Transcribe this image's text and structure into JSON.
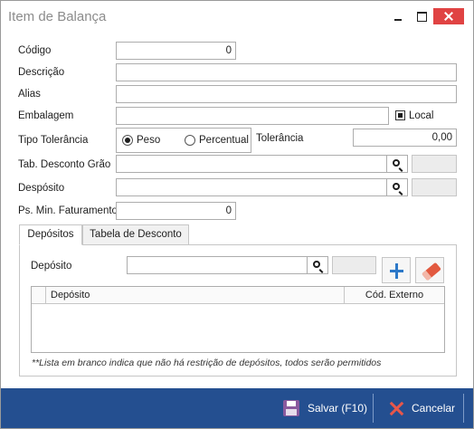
{
  "window": {
    "title": "Item de Balança"
  },
  "form": {
    "codigo": {
      "label": "Código",
      "value": "0"
    },
    "descricao": {
      "label": "Descrição",
      "value": ""
    },
    "alias": {
      "label": "Alias",
      "value": ""
    },
    "embalagem": {
      "label": "Embalagem",
      "value": "",
      "local_label": "Local",
      "local_checked": true
    },
    "tipo_tolerancia": {
      "label": "Tipo Tolerância",
      "options": [
        "Peso",
        "Percentual"
      ],
      "selected": "Peso"
    },
    "tolerancia": {
      "label": "Tolerância",
      "value": "0,00"
    },
    "tab_desconto_grao": {
      "label": "Tab. Desconto Grão",
      "value": "",
      "code": ""
    },
    "deposito": {
      "label": "Despósito",
      "value": "",
      "code": ""
    },
    "ps_min_faturamento": {
      "label": "Ps. Min. Faturamento",
      "value": "0"
    }
  },
  "tabs": [
    {
      "label": "Depósitos",
      "active": true
    },
    {
      "label": "Tabela de Desconto",
      "active": false
    }
  ],
  "depositos_tab": {
    "deposito_label": "Depósito",
    "deposito_value": "",
    "deposito_code": "",
    "grid_columns": [
      "Depósito",
      "Cód. Externo"
    ],
    "rows": [],
    "note": "**Lista em branco indica que não há restrição de depósitos, todos serão permitidos"
  },
  "footer": {
    "save_label": "Salvar (F10)",
    "cancel_label": "Cancelar"
  },
  "colors": {
    "footer_bg": "#244f90",
    "close_button": "#e04343",
    "add_icon": "#2c78c8",
    "cancel_icon": "#e8574a"
  }
}
